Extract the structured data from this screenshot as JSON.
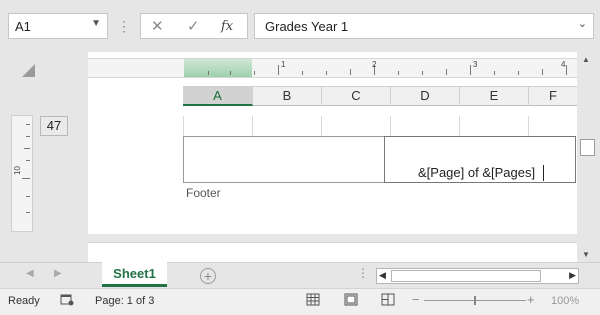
{
  "formula_bar": {
    "name_box": "A1",
    "cancel_icon": "✕",
    "enter_icon": "✓",
    "function_icon": "fx",
    "formula_value": "Grades Year 1"
  },
  "ruler": {
    "h_numbers": [
      "1",
      "2",
      "3",
      "4"
    ],
    "v_number": "10"
  },
  "row_header": "47",
  "column_headers": [
    "A",
    "B",
    "C",
    "D",
    "E",
    "F"
  ],
  "active_column": "A",
  "footer": {
    "right_text": "&[Page] of &[Pages]",
    "label": "Footer"
  },
  "sheet_tabs": [
    {
      "label": "Sheet1",
      "active": true
    }
  ],
  "status_bar": {
    "ready": "Ready",
    "page_info": "Page: 1 of 3",
    "zoom_minus": "−",
    "zoom_plus": "+",
    "zoom": "100%",
    "zoom_fraction": 0.5
  },
  "colors": {
    "accent": "#217346",
    "ruler_highlight": "#9fd0ad"
  },
  "icons": {
    "tab_prev": "◀",
    "tab_next": "▶",
    "add_sheet": "+",
    "more_dots": "⋮",
    "scroll_up": "▲",
    "scroll_down": "▼",
    "scroll_left": "◀",
    "scroll_right": "▶",
    "dropdown": "⌄"
  }
}
